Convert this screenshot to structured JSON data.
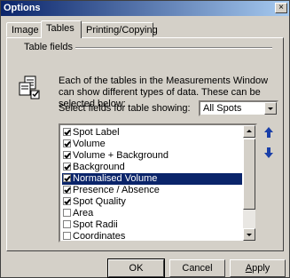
{
  "window": {
    "title": "Options",
    "close_label": "×"
  },
  "tabs": [
    {
      "label": "Image"
    },
    {
      "label": "Tables"
    },
    {
      "label": "Printing/Copying"
    }
  ],
  "group": {
    "label": "Table fields",
    "description": "Each of the tables in the Measurements Window can show different types of data.  These can be selected below:",
    "select_label": "Select fields for table showing:",
    "select_value": "All Spots"
  },
  "fields": [
    {
      "label": "Spot Label",
      "checked": true
    },
    {
      "label": "Volume",
      "checked": true
    },
    {
      "label": "Volume + Background",
      "checked": true
    },
    {
      "label": "Background",
      "checked": true
    },
    {
      "label": "Normalised Volume",
      "checked": true,
      "selected": true
    },
    {
      "label": "Presence / Absence",
      "checked": true
    },
    {
      "label": "Spot Quality",
      "checked": true
    },
    {
      "label": "Area",
      "checked": false
    },
    {
      "label": "Spot Radii",
      "checked": false
    },
    {
      "label": "Coordinates",
      "checked": false
    }
  ],
  "buttons": {
    "ok": "OK",
    "cancel": "Cancel",
    "apply_first": "A",
    "apply_rest": "pply"
  },
  "colors": {
    "selection": "#0a246a",
    "arrow": "#1a3fa8"
  }
}
